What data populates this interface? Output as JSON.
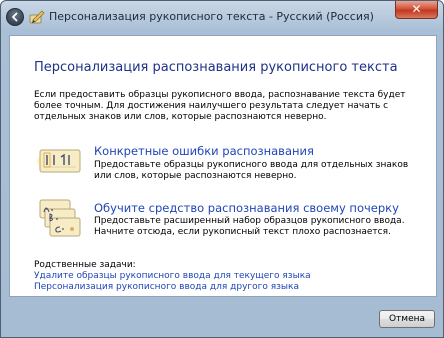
{
  "window": {
    "title": "Персонализация рукописного текста - Русский (Россия)",
    "close_label": "✕"
  },
  "main": {
    "heading": "Персонализация распознавания рукописного текста",
    "intro": "Если предоставить образцы рукописного ввода, распознавание текста будет более точным. Для достижения наилучшего результата следует начать с отдельных знаков или слов, которые распознаются неверно.",
    "options": [
      {
        "title": "Конкретные ошибки распознавания",
        "description": "Предоставьте образцы рукописного ввода для отдельных знаков или слов, которые распознаются неверно.",
        "icon": "handwriting-errors-icon"
      },
      {
        "title": "Обучите средство распознавания своему почерку",
        "description": "Предоставьте расширенный набор образцов рукописного ввода. Начните отсюда, если рукописный текст плохо распознается.",
        "icon": "handwriting-training-icon"
      }
    ],
    "related": {
      "label": "Родственные задачи:",
      "links": [
        "Удалите образцы рукописного ввода для текущего языка",
        "Персонализация рукописного ввода для другого языка"
      ]
    }
  },
  "footer": {
    "cancel_label": "Отмена"
  },
  "colors": {
    "heading": "#1e3287",
    "link": "#1f46b6",
    "frame": "#a9bfd6",
    "close": "#c2381f"
  }
}
